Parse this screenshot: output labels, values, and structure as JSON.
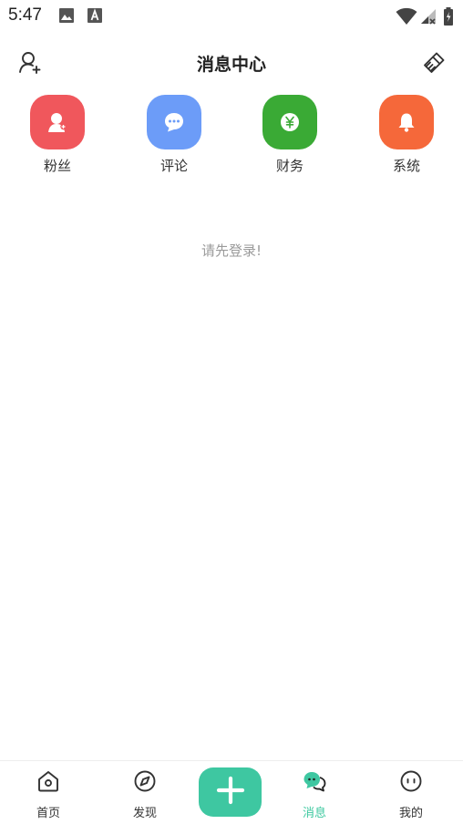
{
  "status_bar": {
    "time": "5:47",
    "icons": [
      "image-icon",
      "font-icon",
      "wifi-icon",
      "signal-icon",
      "battery-icon"
    ]
  },
  "header": {
    "title": "消息中心",
    "left_icon": "add-friend-icon",
    "right_icon": "clear-brush-icon"
  },
  "categories": [
    {
      "label": "粉丝",
      "icon": "fans-icon",
      "color": "#f0575c"
    },
    {
      "label": "评论",
      "icon": "comment-icon",
      "color": "#6c9cf8"
    },
    {
      "label": "财务",
      "icon": "yuan-icon",
      "color": "#3aaa35"
    },
    {
      "label": "系统",
      "icon": "bell-icon",
      "color": "#f5683a"
    }
  ],
  "empty_message": "请先登录!",
  "nav": {
    "items": [
      {
        "label": "首页",
        "icon": "home-icon"
      },
      {
        "label": "发现",
        "icon": "compass-icon"
      },
      {
        "label": "消息",
        "icon": "message-icon",
        "active": true
      },
      {
        "label": "我的",
        "icon": "profile-icon"
      }
    ],
    "add_icon": "plus-icon"
  },
  "colors": {
    "accent": "#3ec7a1",
    "text": "#222222",
    "muted": "#9a9a9a"
  }
}
